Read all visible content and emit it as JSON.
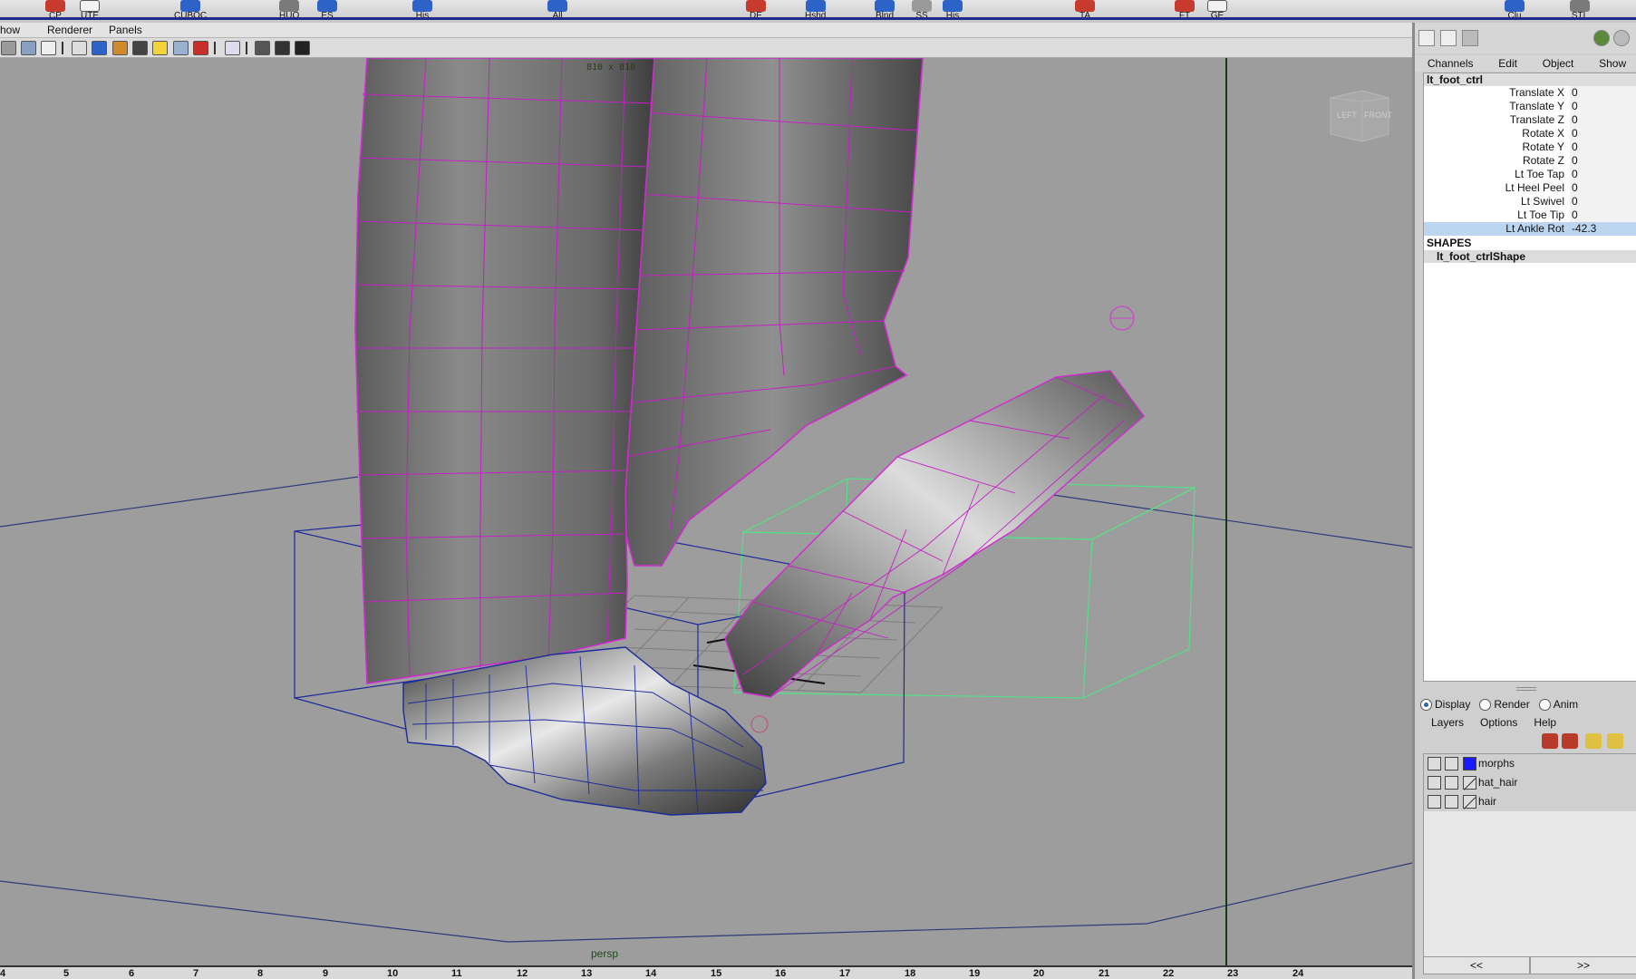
{
  "shelf": {
    "labels": [
      "CP",
      "UTE",
      "CUBOC",
      "HUO",
      "ES",
      "His",
      "All",
      "DE",
      "Hshd",
      "Blnd",
      "SS",
      "His",
      "TA",
      "FT",
      "GE",
      "Clu",
      "STL"
    ]
  },
  "viewport": {
    "menus": [
      "how",
      "Renderer",
      "Panels"
    ],
    "resolution": "810 x 810",
    "camera": "persp",
    "viewcube": {
      "left": "LEFT",
      "front": "FRONT"
    }
  },
  "timeline": {
    "ticks": [
      "4",
      "5",
      "6",
      "7",
      "8",
      "9",
      "10",
      "11",
      "12",
      "13",
      "14",
      "15",
      "16",
      "17",
      "18",
      "19",
      "20",
      "21",
      "22",
      "23",
      "24"
    ]
  },
  "channel_box": {
    "menus": [
      "Channels",
      "Edit",
      "Object",
      "Show"
    ],
    "object_name": "lt_foot_ctrl",
    "attributes": [
      {
        "name": "Translate X",
        "value": "0"
      },
      {
        "name": "Translate Y",
        "value": "0"
      },
      {
        "name": "Translate Z",
        "value": "0"
      },
      {
        "name": "Rotate X",
        "value": "0"
      },
      {
        "name": "Rotate Y",
        "value": "0"
      },
      {
        "name": "Rotate Z",
        "value": "0"
      },
      {
        "name": "Lt Toe Tap",
        "value": "0"
      },
      {
        "name": "Lt Heel Peel",
        "value": "0"
      },
      {
        "name": "Lt Swivel",
        "value": "0"
      },
      {
        "name": "Lt Toe Tip",
        "value": "0"
      },
      {
        "name": "Lt Ankle Rot",
        "value": "-42.3"
      }
    ],
    "selected_attribute_index": 10,
    "shapes_title": "SHAPES",
    "shape_node": "lt_foot_ctrlShape"
  },
  "layer_editor": {
    "tabs": [
      "Display",
      "Render",
      "Anim"
    ],
    "active_tab": "Display",
    "menus": [
      "Layers",
      "Options",
      "Help"
    ],
    "layers": [
      {
        "name": "morphs",
        "color": "#1a1aff"
      },
      {
        "name": "hat_hair",
        "color": ""
      },
      {
        "name": "hair",
        "color": ""
      }
    ],
    "prev_label": "<<",
    "next_label": ">>"
  }
}
